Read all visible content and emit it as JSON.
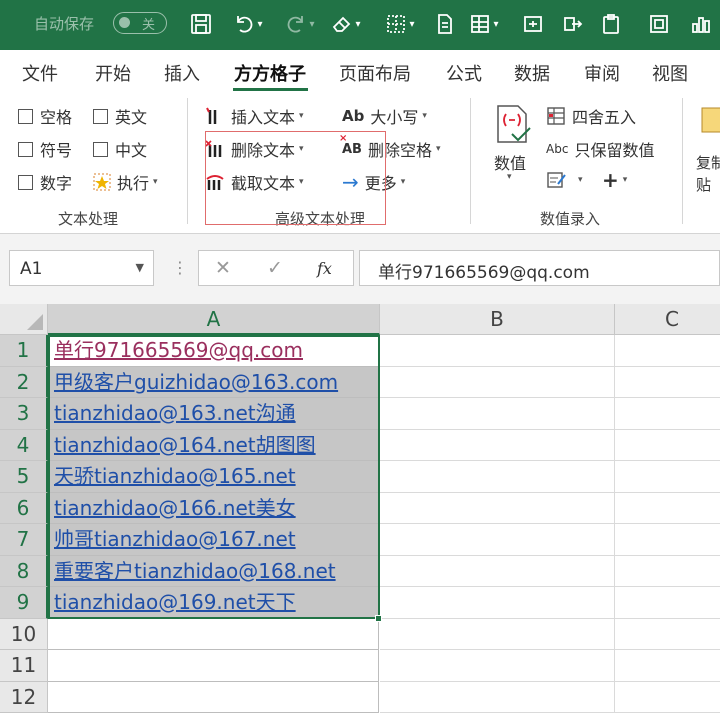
{
  "titlebar": {
    "autosave_label": "自动保存",
    "autosave_state": "关",
    "accent_color": "#217346"
  },
  "tabs": [
    {
      "label": "文件"
    },
    {
      "label": "开始"
    },
    {
      "label": "插入"
    },
    {
      "label": "方方格子",
      "active": true
    },
    {
      "label": "页面布局"
    },
    {
      "label": "公式"
    },
    {
      "label": "数据"
    },
    {
      "label": "审阅"
    },
    {
      "label": "视图"
    }
  ],
  "ribbon": {
    "text_processing": {
      "checkboxes": [
        "空格",
        "英文",
        "符号",
        "中文",
        "数字"
      ],
      "execute_label": "执行",
      "group_label": "文本处理"
    },
    "advanced_text": {
      "insert_text": "插入文本",
      "delete_text": "删除文本",
      "extract_text": "截取文本",
      "case_icon_text": "Ab",
      "case_label": "大小写",
      "delete_space_icon_text": "AB",
      "delete_space": "删除空格",
      "more": "更多",
      "group_label": "高级文本处理"
    },
    "numeric_entry": {
      "number_label": "数值",
      "round_label": "四舍五入",
      "abc_icon_text": "Abc",
      "keep_numbers_label": "只保留数值",
      "plus_label": "+",
      "group_label": "数值录入"
    },
    "clipped_label": "复制\n贴"
  },
  "formula_bar": {
    "name_box": "A1",
    "fx_label": "fx",
    "content": "单行971665569@qq.com"
  },
  "grid": {
    "columns": [
      "A",
      "B",
      "C"
    ],
    "row_numbers": [
      "1",
      "2",
      "3",
      "4",
      "5",
      "6",
      "7",
      "8",
      "9",
      "10",
      "11",
      "12"
    ],
    "column_a_values": [
      "单行971665569@qq.com",
      "甲级客户guizhidao@163.com",
      "tianzhidao@163.net沟通",
      "tianzhidao@164.net胡图图",
      "天骄tianzhidao@165.net",
      "tianzhidao@166.net美女",
      "帅哥tianzhidao@167.net",
      "重要客户tianzhidao@168.net",
      "tianzhidao@169.net天下"
    ]
  }
}
